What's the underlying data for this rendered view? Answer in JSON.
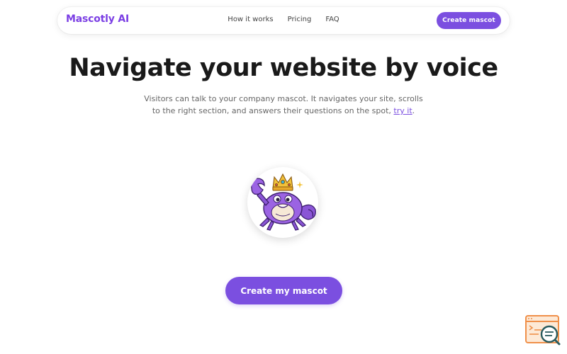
{
  "nav": {
    "logo": "Mascotly AI",
    "links": [
      "How it works",
      "Pricing",
      "FAQ"
    ],
    "cta": "Create mascot"
  },
  "hero": {
    "title": "Navigate your website by voice",
    "subtitle": "Visitors can talk to your company mascot. It navigates your site, scrolls to the right section, and answers their questions on the spot,",
    "subtitle_link": "try it",
    "subtitle_end": "."
  },
  "mascot": {
    "icon": "crab-king-mascot-icon"
  },
  "cta": {
    "label": "Create my mascot"
  },
  "widget": {
    "icon": "chat-search-widget-icon"
  },
  "colors": {
    "accent": "#7b4fe0",
    "logo": "#7b3fe4",
    "widget_orange": "#f0904a",
    "widget_teal": "#2a5b5e"
  }
}
